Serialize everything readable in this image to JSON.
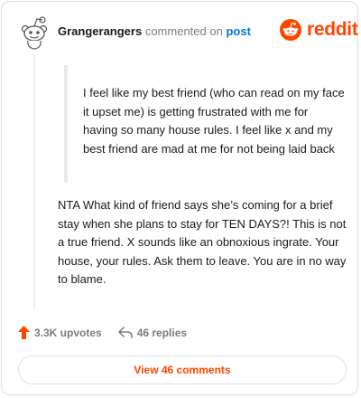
{
  "header": {
    "username": "Grangerangers",
    "action_text": "commented on",
    "post_link": "post"
  },
  "brand": {
    "wordmark": "reddit",
    "color": "#ff4500",
    "icon": "reddit-snoo-icon"
  },
  "parent_quote": "I feel like my best friend (who can read on my face it upset me) is getting frustrated with me for having so many house rules. I feel like x and my best friend are mad at me for not being laid back",
  "comment_body": "NTA What kind of friend says she’s coming for a brief stay when she plans to stay for TEN DAYS?! This is not a true friend. X sounds like an obnoxious ingrate. Your house, your rules. Ask them to leave. You are in no way to blame.",
  "actions": {
    "upvotes": "3.3K upvotes",
    "replies": "46 replies"
  },
  "view_comments_label": "View 46 comments"
}
